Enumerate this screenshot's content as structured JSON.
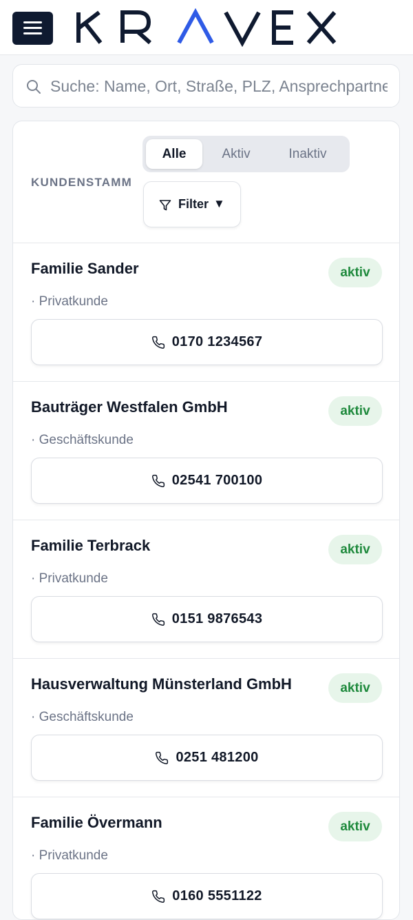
{
  "header": {
    "logo_text": "KRAVEX",
    "menu_icon": "hamburger-menu-icon"
  },
  "search": {
    "placeholder": "Suche: Name, Ort, Straße, PLZ, Ansprechpartner",
    "value": ""
  },
  "customers_panel": {
    "title": "KUNDENSTAMM",
    "segments": [
      {
        "label": "Alle",
        "active": true
      },
      {
        "label": "Aktiv",
        "active": false
      },
      {
        "label": "Inaktiv",
        "active": false
      }
    ],
    "filter": {
      "label": "Filter",
      "caret": "▼",
      "icon": "filter-icon"
    },
    "customers": [
      {
        "name": "Familie Sander",
        "type": "· Privatkunde",
        "status": "aktiv",
        "phone": "0170 1234567"
      },
      {
        "name": "Bauträger Westfalen GmbH",
        "type": "· Geschäftskunde",
        "status": "aktiv",
        "phone": "02541 700100"
      },
      {
        "name": "Familie Terbrack",
        "type": "· Privatkunde",
        "status": "aktiv",
        "phone": "0151 9876543"
      },
      {
        "name": "Hausverwaltung Münsterland GmbH",
        "type": "· Geschäftskunde",
        "status": "aktiv",
        "phone": "0251 481200"
      },
      {
        "name": "Familie Övermann",
        "type": "· Privatkunde",
        "status": "aktiv",
        "phone": "0160 5551122"
      }
    ]
  },
  "colors": {
    "navy": "#0f1a30",
    "logo_accent": "#2f5be6",
    "badge_bg": "#e7f5ea",
    "badge_text": "#1f8a3d",
    "muted": "#6b7386"
  }
}
